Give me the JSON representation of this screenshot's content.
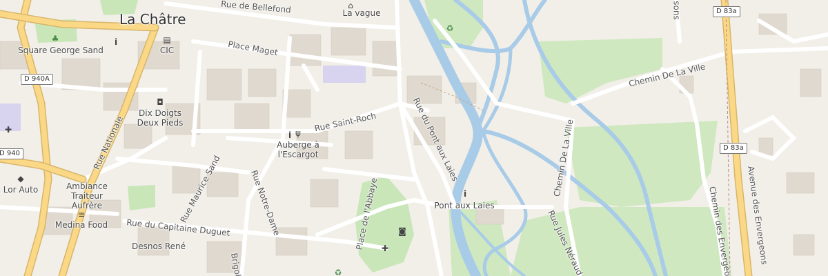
{
  "map": {
    "town_name": "La Châtre",
    "colors": {
      "background": "#f2efe9",
      "building": "#e0d9cf",
      "water": "#a8cbe8",
      "water_label": "#6ea6d8",
      "park": "#c8e6b8",
      "woodland": "#cfe8c0",
      "major_road": "#fbd885",
      "road": "#ffffff",
      "road_casing": "#d8d0c4"
    },
    "streets": {
      "rue_de_bellefond": "Rue de Bellefond",
      "place_maget": "Place Maget",
      "rue_saint_roch": "Rue Saint-Roch",
      "rue_du_pont_aux_laies": "Rue du Pont aux Laies",
      "rue_nationale": "Rue Nationale",
      "rue_maurice_sand": "Rue Maurice Sand",
      "rue_notre_dame": "Rue Notre-Dame",
      "rue_du_capitaine_duguet": "Rue du Capitaine Duguet",
      "place_de_labbaye": "Place de l'Abbaye",
      "chemin_de_la_ville_1": "Chemin De La Ville",
      "chemin_de_la_ville_2": "Chemin De La Ville",
      "rue_jules_neraud": "Rue Jules Néraud",
      "chemin_des_envergeons": "Chemin des Envergeons",
      "avenue_des_envergeons": "Avenue des Envergeons",
      "brigols": "Brigols",
      "top_right_fragment": "suos"
    },
    "road_refs": {
      "d940a": "D 940A",
      "d940": "D 940",
      "d83a_top": "D 83a",
      "d83a_mid": "D 83a"
    },
    "places": {
      "la_vague": "La vague",
      "square_george_sand": "Square George Sand",
      "cic": "CIC",
      "dix_doigts": "Dix Doigts Deux Pieds",
      "auberge": "Auberge à l'Escargot",
      "lor_auto": "Lor Auto",
      "ambiance_traiteur": "Ambiance Traiteur Aufrère",
      "medina_food": "Medina Food",
      "desnos_rene": "Desnos René",
      "pont_aux_laies": "Pont aux Laies"
    },
    "icons": {
      "info": "info-icon",
      "tree": "tree-icon",
      "bank": "bank-icon",
      "shop_bag": "shopping-bag-icon",
      "restaurant": "restaurant-icon",
      "car": "car-icon",
      "fast_food": "fast-food-icon",
      "camera": "camera-icon",
      "church": "church-icon",
      "recycling": "recycling-icon"
    }
  }
}
